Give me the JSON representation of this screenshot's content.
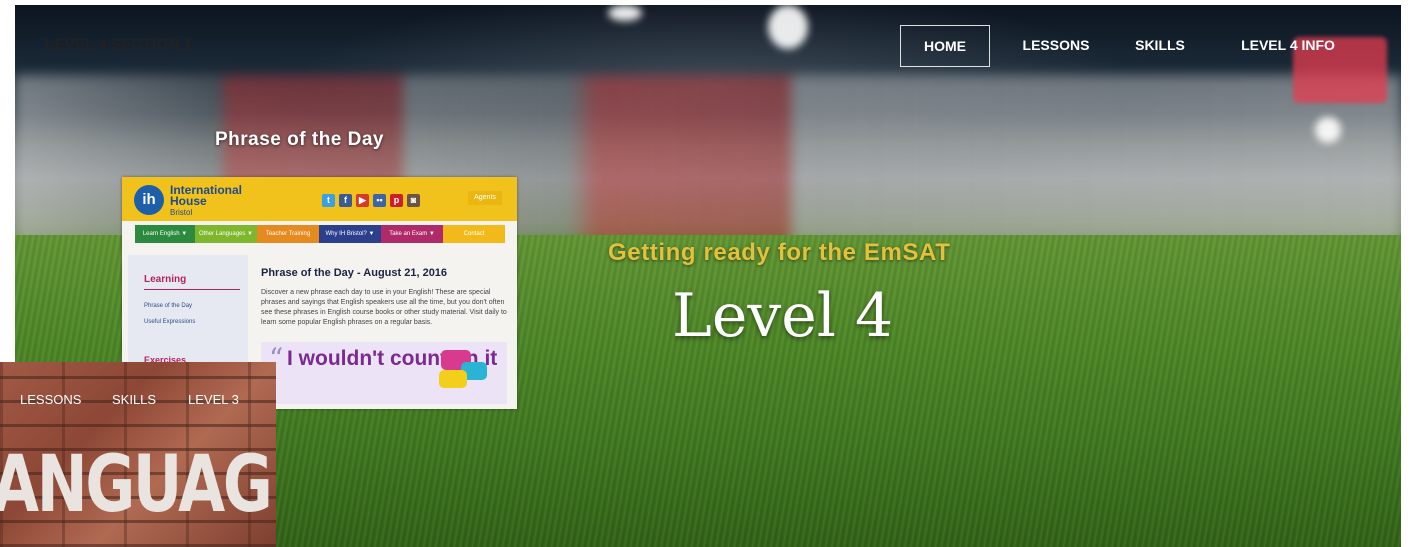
{
  "header": {
    "site_title": "LEVEL 4 SECTION 1",
    "nav": [
      {
        "label": "HOME",
        "active": true
      },
      {
        "label": "LESSONS",
        "active": false
      },
      {
        "label": "SKILLS",
        "active": false
      },
      {
        "label": "LEVEL 4 INFO",
        "active": false
      }
    ]
  },
  "hero": {
    "subtitle": "Getting ready for the EmSAT",
    "title": "Level 4",
    "accent_color": "#e2c13d"
  },
  "phrase_card": {
    "heading": "Phrase of the Day",
    "brand_line1": "International",
    "brand_line2": "House",
    "brand_city": "Bristol",
    "logo_text": "ih",
    "social_icons": [
      "twitter-icon",
      "facebook-icon",
      "youtube-icon",
      "flickr-icon",
      "pinterest-icon",
      "instagram-icon"
    ],
    "agents_label": "Agents",
    "menu": [
      "Learn English ▼",
      "Other Languages ▼",
      "Teacher Training",
      "Why IH Bristol? ▼",
      "Take an Exam ▼",
      "Contact"
    ],
    "sidebar_heading": "Learning",
    "sidebar_links": [
      "Phrase of the Day",
      "Useful Expressions"
    ],
    "sidebar_exercises": "Exercises",
    "article_title": "Phrase of the Day - August 21, 2016",
    "article_body": "Discover a new phrase each day to use in your English! These are special phrases and sayings that English speakers use all the time, but you don't often see these phrases in English course books or other study material. Visit daily to learn some popular English phrases on a regular basis.",
    "quote": "I wouldn't count on it"
  },
  "language_card": {
    "nav": [
      "LESSONS",
      "SKILLS",
      "LEVEL 3"
    ],
    "word": "ANGUAGE"
  }
}
